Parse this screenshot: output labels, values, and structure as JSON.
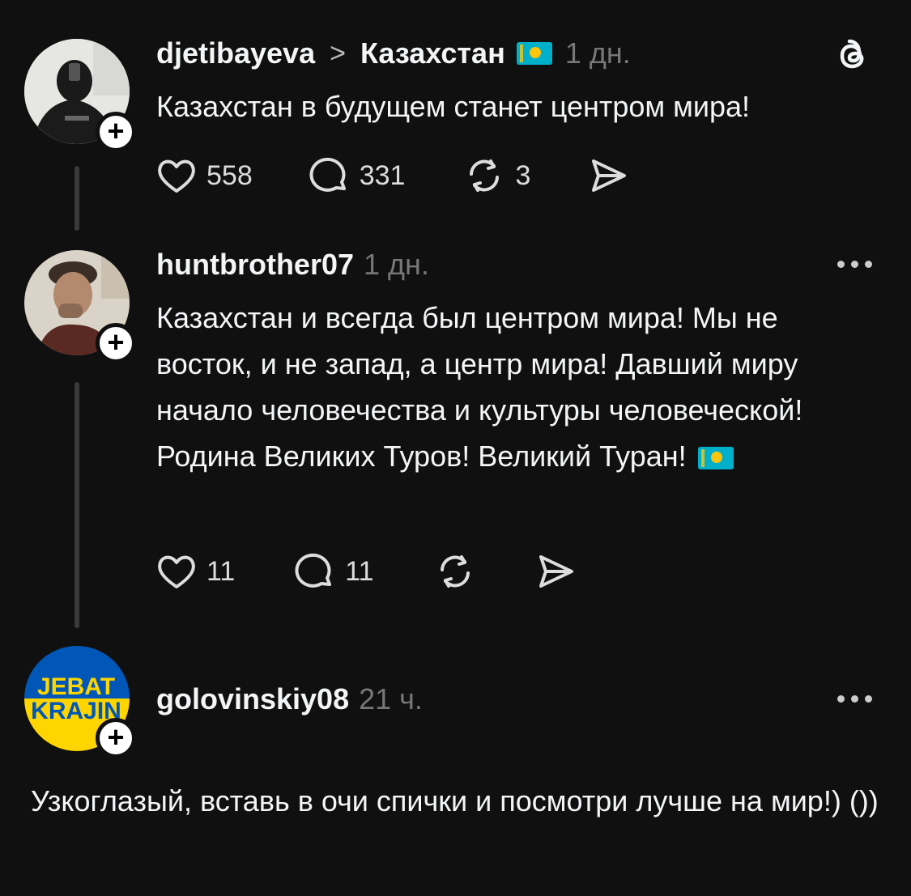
{
  "app": {
    "logo_icon": "threads-logo-icon"
  },
  "posts": [
    {
      "username": "djetibayeva",
      "chevron": ">",
      "community": "Казахстан",
      "time": "1 дн.",
      "text": "Казахстан в будущем станет центром мира!",
      "likes": "558",
      "replies": "331",
      "reposts": "3"
    },
    {
      "username": "huntbrother07",
      "time": "1 дн.",
      "text": "Казахстан и всегда был центром мира! Мы не восток, и не запад, а центр мира! Давший миру начало человечества и культуры человеческой! Родина Великих Туров! Великий Туран!",
      "likes": "11",
      "replies": "11"
    },
    {
      "username": "golovinskiy08",
      "time": "21 ч.",
      "avatar_text_1": "JEBAT",
      "avatar_text_2": "KRAJIN",
      "text": "Узкоглазый, вставь в очи спички и посмотри лучше на мир!) ())"
    }
  ],
  "colors": {
    "background": "#101010",
    "text": "#f3f5f7",
    "muted": "#777777",
    "flag_blue": "#00AFCA",
    "flag_yellow": "#FEC50C"
  }
}
